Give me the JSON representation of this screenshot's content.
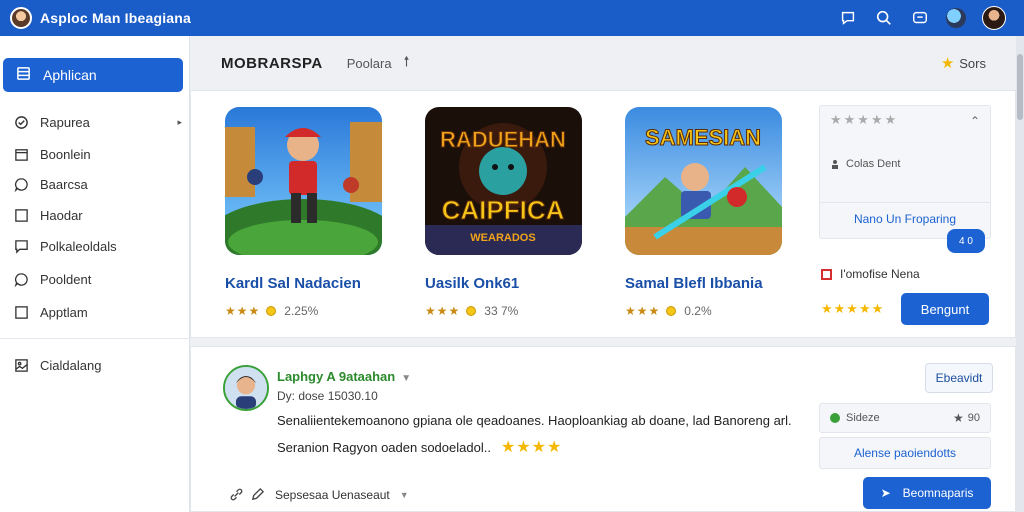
{
  "header": {
    "title": "Asploc Man Ibeagiana",
    "icons": [
      "chat-icon",
      "search-icon",
      "message-icon",
      "globe-avatar",
      "user-avatar"
    ]
  },
  "sidebar": {
    "primary": {
      "label": "Aphlican",
      "icon": "list-icon"
    },
    "items": [
      {
        "label": "Rapurea",
        "icon": "check-circle-icon",
        "has_caret": true
      },
      {
        "label": "Boonlein",
        "icon": "calendar-icon"
      },
      {
        "label": "Baarcsa",
        "icon": "chat-bubble-icon"
      },
      {
        "label": "Haodar",
        "icon": "square-icon"
      },
      {
        "label": "Polkaleoldals",
        "icon": "chat-square-icon"
      },
      {
        "label": "Pooldent",
        "icon": "chat-bubble-icon"
      },
      {
        "label": "Apptlam",
        "icon": "square-icon"
      }
    ],
    "bottom_item": {
      "label": "Cialdalang",
      "icon": "gallery-icon"
    }
  },
  "main": {
    "section_title": "MOBRARSPA",
    "section_sub": "Poolara",
    "sort_label": "Sors",
    "games": [
      {
        "name": "Kardl Sal Nadacien",
        "rating_text": "2.25%",
        "art": "hero",
        "accent": "#2f7a2a"
      },
      {
        "name": "Uasilk Onk61",
        "rating_text": "33 7%",
        "art_title": "RADUEHAN",
        "art_sub": "CAIPFICA",
        "art_tag": "WEARADOS",
        "accent": "#f0a31a"
      },
      {
        "name": "Samal Blefl Ibbania",
        "rating_text": "0.2%",
        "art_title": "SAMESIAN",
        "accent": "#3b8be0"
      }
    ],
    "panel": {
      "item": "Colas Dent",
      "link": "Nano Un Froparing",
      "pill": "4 0"
    },
    "report_label": "I'omofise Nena",
    "primary_button": "Bengunt"
  },
  "review": {
    "name": "Laphgy A 9ataahan",
    "date": "Dy: dose 15030.10",
    "line1": "Senaliientekemoanono gpiana ole qeadoanes. Haoploankiag ab doane, lad Banoreng arl.",
    "line2": "Seranion Ragyon oaden sodoeladol..",
    "footer_label": "Sepsesaa Uenaseaut",
    "outline_button": "Ebeavidt",
    "like_label": "Sideze",
    "like_count": "90",
    "plain_link": "Alense paoiendotts",
    "cta_button": "Beomnaparis"
  }
}
